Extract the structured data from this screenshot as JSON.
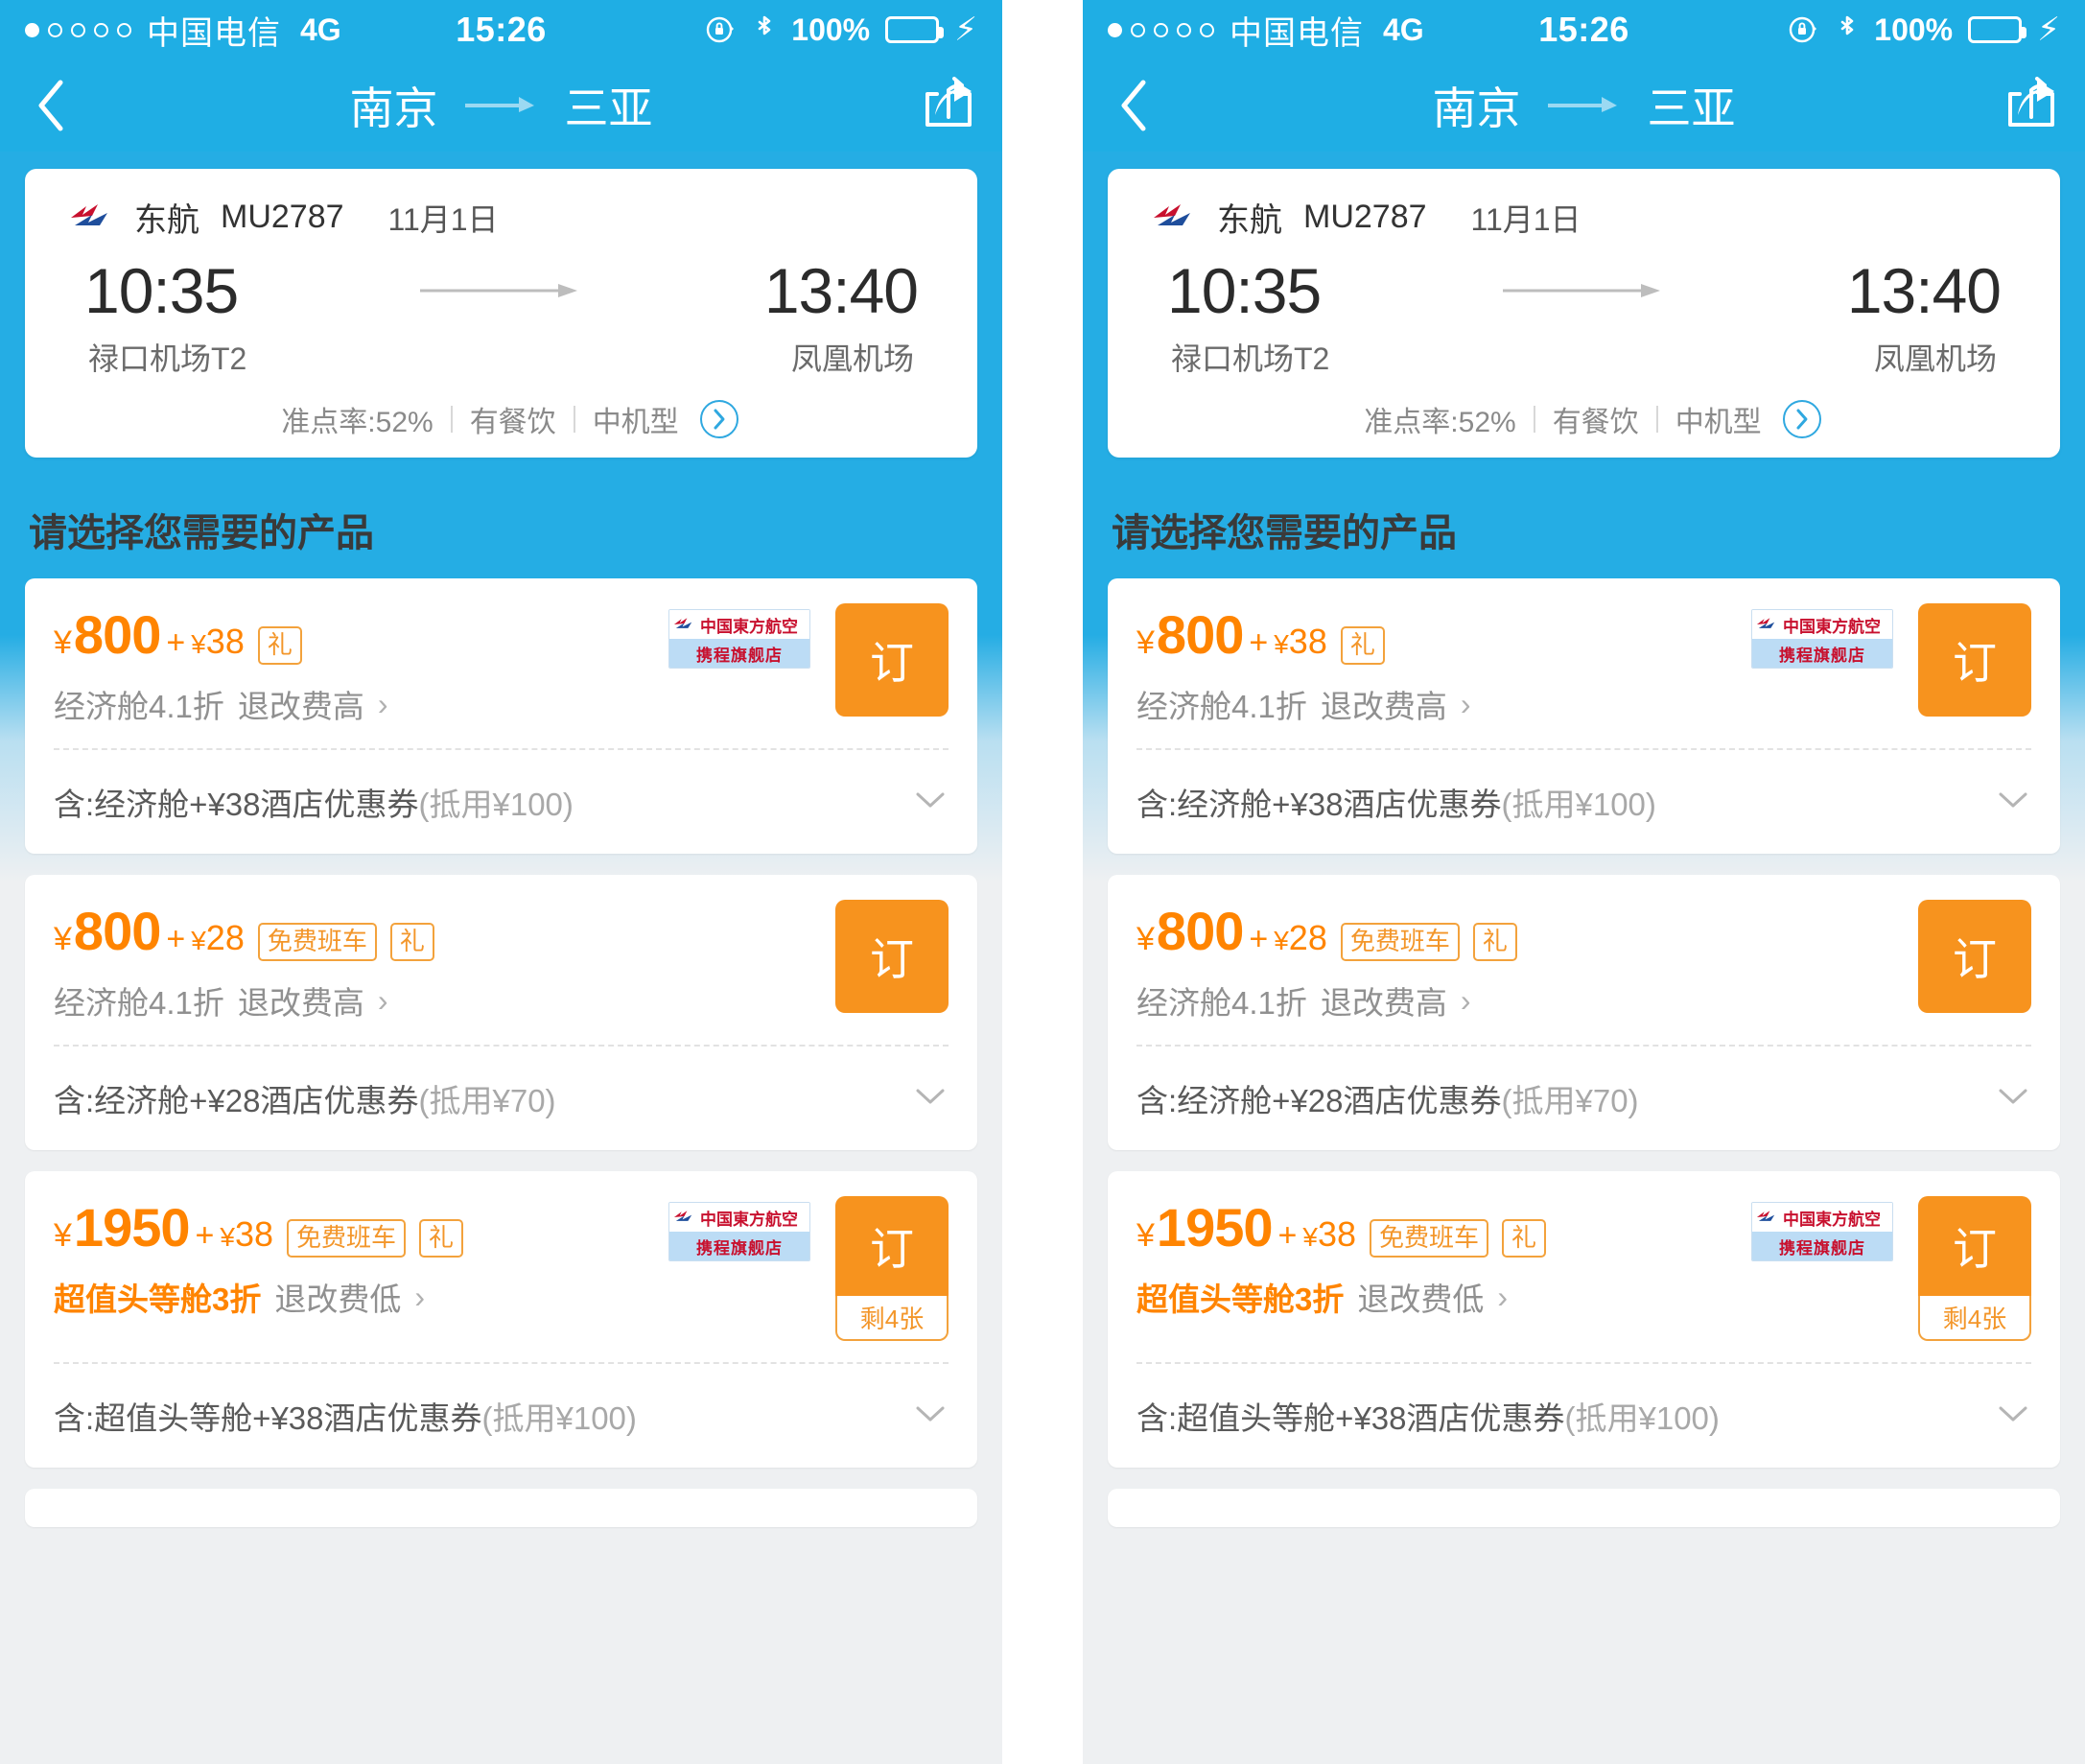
{
  "status_bar": {
    "signal_dots": [
      true,
      false,
      false,
      false,
      false
    ],
    "carrier": "中国电信",
    "network": "4G",
    "time": "15:26",
    "rotation_lock_icon": "rotation-lock-icon",
    "bluetooth_icon": "bluetooth-icon",
    "battery_percent": "100%",
    "battery_color": "#4cd964",
    "charging_icon": "lightning-bolt-icon"
  },
  "nav": {
    "back_icon": "chevron-left-icon",
    "origin": "南京",
    "arrow_icon": "arrow-right-icon",
    "destination": "三亚",
    "share_icon": "share-icon",
    "bar_color": "#1faee4"
  },
  "flight": {
    "airline_logo": "china-eastern-logo",
    "airline": "东航",
    "flight_no": "MU2787",
    "date": "11月1日",
    "depart_time": "10:35",
    "arrive_time": "13:40",
    "depart_airport": "禄口机场T2",
    "arrive_airport": "凤凰机场",
    "meta": [
      "准点率:52%",
      "有餐饮",
      "中机型"
    ],
    "detail_chevron_icon": "chevron-right-circle-icon"
  },
  "section": {
    "title": "请选择您需要的产品"
  },
  "products": [
    {
      "currency": "¥",
      "price": "800",
      "plus": "+",
      "fee_currency": "¥",
      "fee": "38",
      "tags": [
        "礼"
      ],
      "cabin": "经济舱4.1折",
      "cabin_highlight": false,
      "refund": "退改费高",
      "chevron_icon": "chevron-right-icon",
      "vendor_badge": {
        "visible": true,
        "top_text": "中国東方航空",
        "bottom_text": "携程旗舰店",
        "logo": "china-eastern-logo"
      },
      "book_label": "订",
      "stock_label": "",
      "include_prefix": "含:经济舱+¥38酒店优惠券",
      "include_suffix": "(抵用¥100)",
      "expand_icon": "chevron-down-icon"
    },
    {
      "currency": "¥",
      "price": "800",
      "plus": "+",
      "fee_currency": "¥",
      "fee": "28",
      "tags": [
        "免费班车",
        "礼"
      ],
      "cabin": "经济舱4.1折",
      "cabin_highlight": false,
      "refund": "退改费高",
      "chevron_icon": "chevron-right-icon",
      "vendor_badge": {
        "visible": false,
        "top_text": "",
        "bottom_text": "",
        "logo": ""
      },
      "book_label": "订",
      "stock_label": "",
      "include_prefix": "含:经济舱+¥28酒店优惠券",
      "include_suffix": "(抵用¥70)",
      "expand_icon": "chevron-down-icon"
    },
    {
      "currency": "¥",
      "price": "1950",
      "plus": "+",
      "fee_currency": "¥",
      "fee": "38",
      "tags": [
        "免费班车",
        "礼"
      ],
      "cabin": "超值头等舱3折",
      "cabin_highlight": true,
      "refund": "退改费低",
      "chevron_icon": "chevron-right-icon",
      "vendor_badge": {
        "visible": true,
        "top_text": "中国東方航空",
        "bottom_text": "携程旗舰店",
        "logo": "china-eastern-logo"
      },
      "book_label": "订",
      "stock_label": "剩4张",
      "include_prefix": "含:超值头等舱+¥38酒店优惠券",
      "include_suffix": "(抵用¥100)",
      "expand_icon": "chevron-down-icon"
    }
  ],
  "theme": {
    "accent_blue": "#1faee4",
    "accent_orange": "#ff8400",
    "button_orange": "#f7931e",
    "page_bg": "#eef0f2"
  }
}
